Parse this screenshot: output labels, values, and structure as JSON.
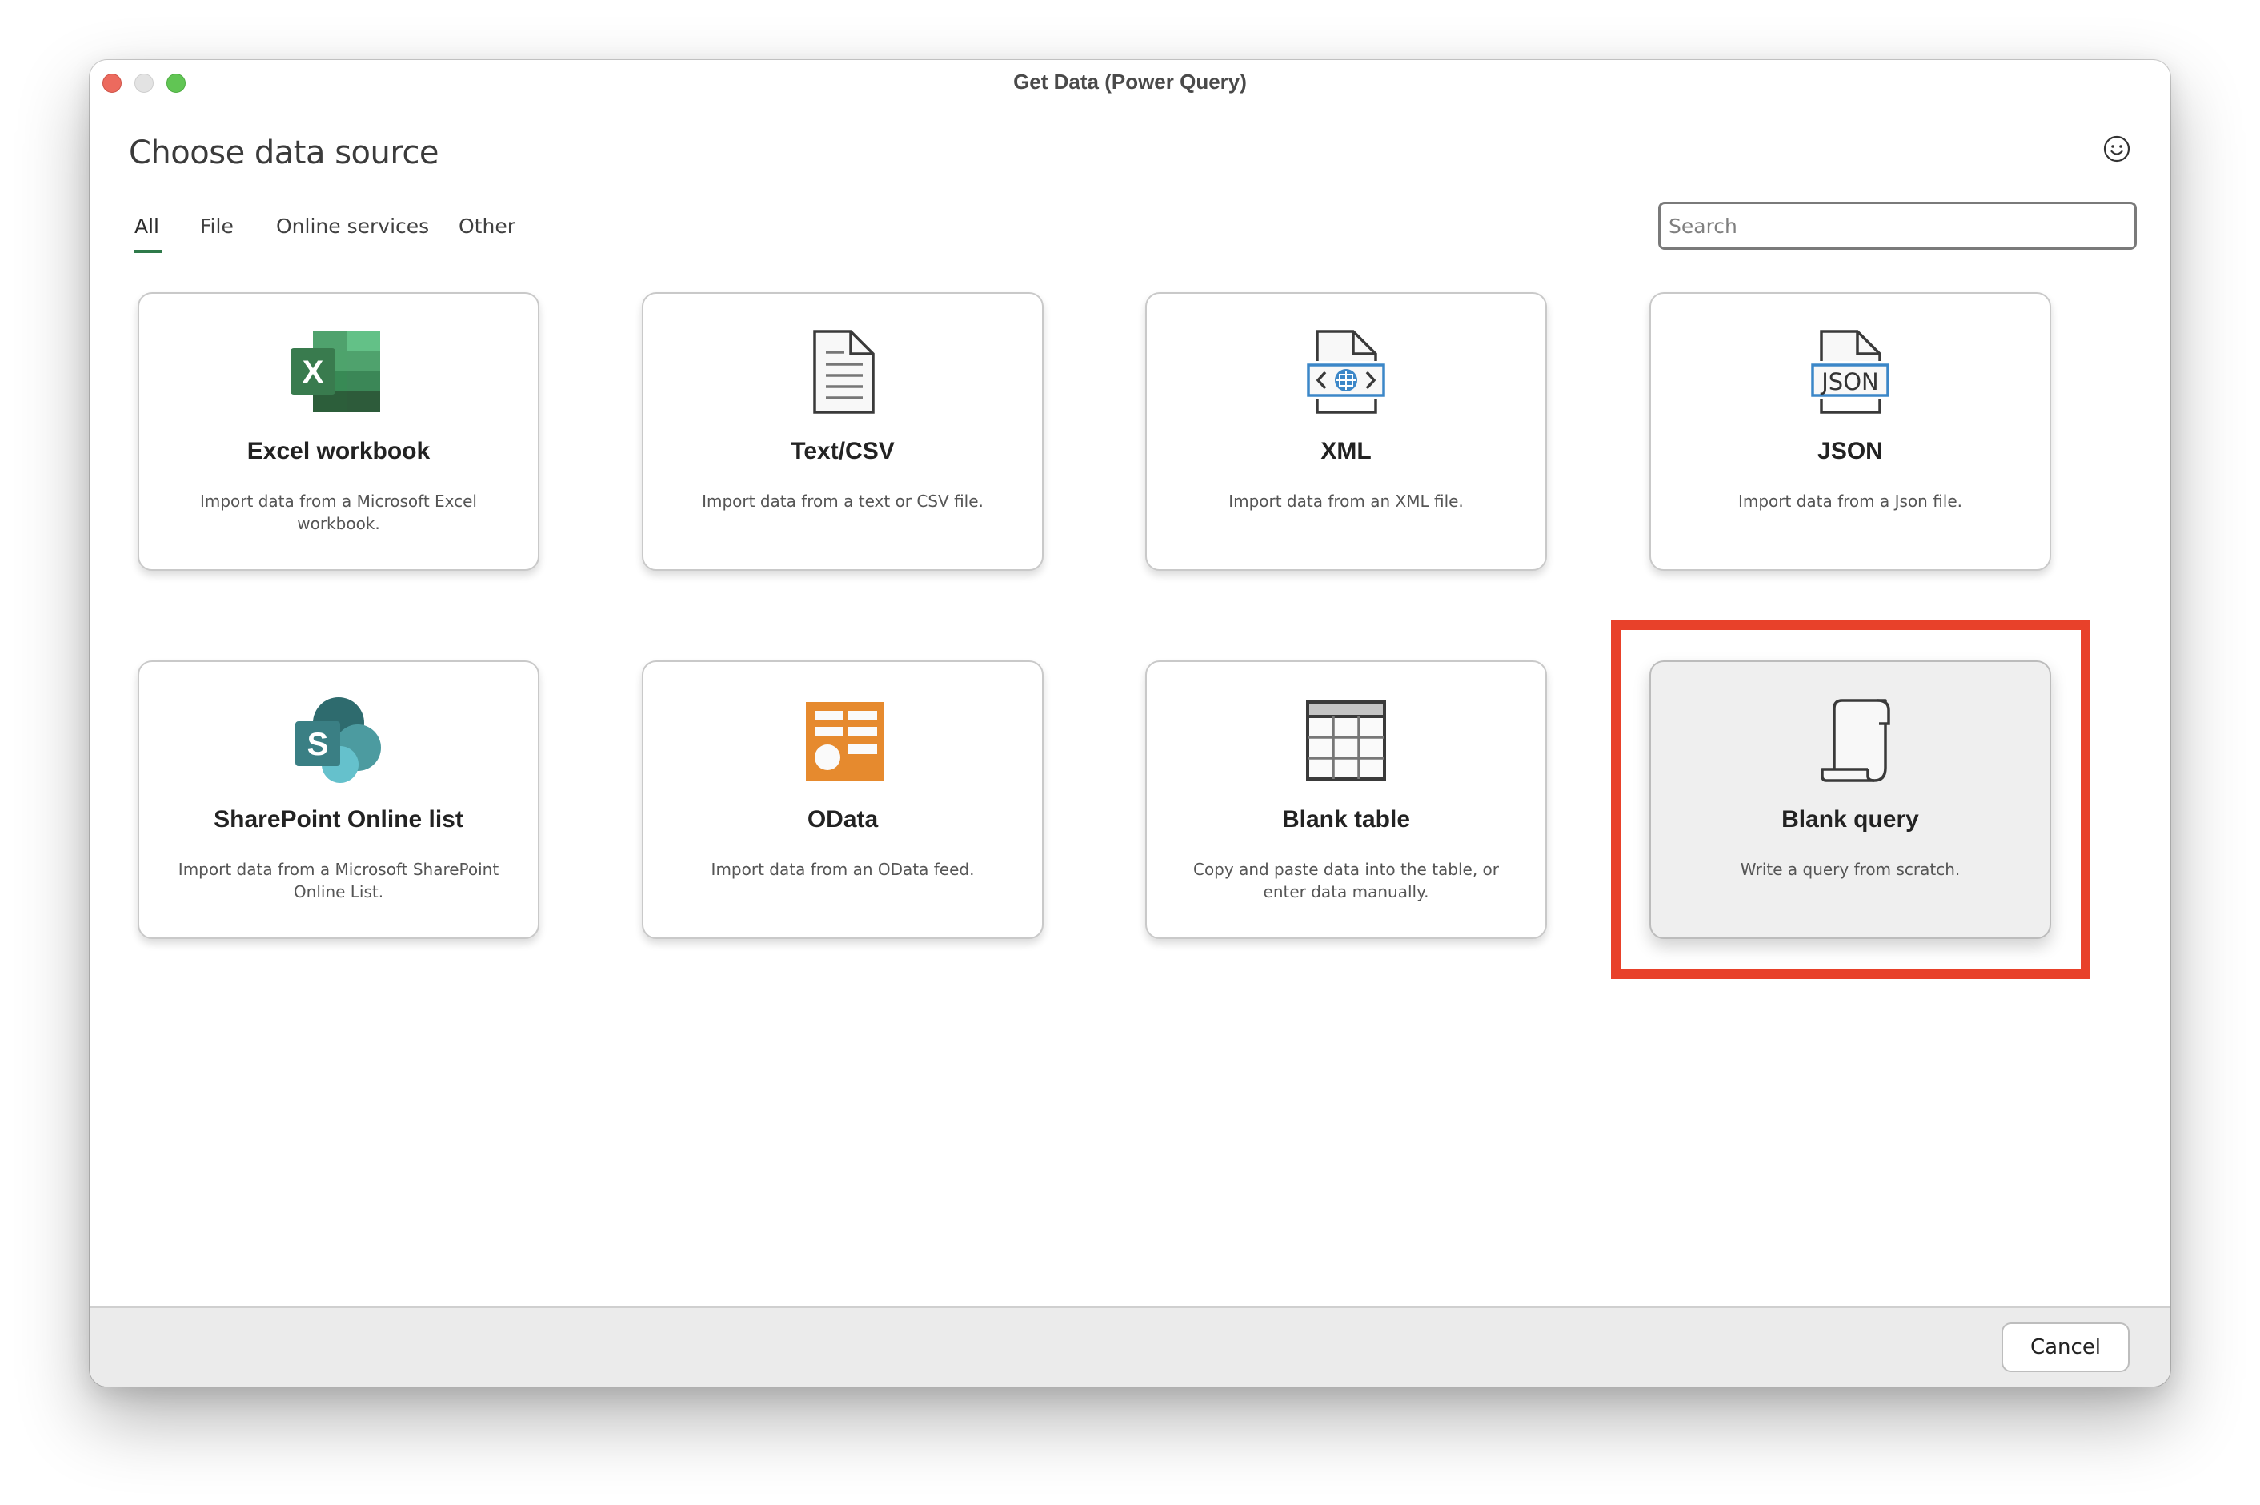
{
  "window": {
    "title": "Get Data (Power Query)"
  },
  "header": {
    "heading": "Choose data source",
    "feedback_icon": "smiley-icon"
  },
  "tabs": [
    {
      "label": "All",
      "active": true
    },
    {
      "label": "File",
      "active": false
    },
    {
      "label": "Online services",
      "active": false
    },
    {
      "label": "Other",
      "active": false
    }
  ],
  "search": {
    "placeholder": "Search",
    "value": ""
  },
  "sources": [
    {
      "title": "Excel workbook",
      "description": "Import data from a Microsoft Excel workbook.",
      "icon": "excel-icon"
    },
    {
      "title": "Text/CSV",
      "description": "Import data from a text or CSV file.",
      "icon": "text-file-icon"
    },
    {
      "title": "XML",
      "description": "Import data from an XML file.",
      "icon": "xml-file-icon"
    },
    {
      "title": "JSON",
      "description": "Import data from a Json file.",
      "icon": "json-file-icon",
      "icon_text": "JSON"
    },
    {
      "title": "SharePoint Online list",
      "description": "Import data from a Microsoft SharePoint Online List.",
      "icon": "sharepoint-icon",
      "icon_text": "S"
    },
    {
      "title": "OData",
      "description": "Import data from an OData feed.",
      "icon": "odata-icon"
    },
    {
      "title": "Blank table",
      "description": "Copy and paste data into the table, or enter data manually.",
      "icon": "table-icon"
    },
    {
      "title": "Blank query",
      "description": "Write a query from scratch.",
      "icon": "scroll-icon",
      "selected": true
    }
  ],
  "excel_icon_letter": "X",
  "footer": {
    "cancel_label": "Cancel"
  },
  "colors": {
    "tab_accent": "#2f7a4a",
    "highlight": "#e8412a",
    "excel_green": "#217346",
    "sharepoint_teal": "#036c70",
    "odata_orange": "#e68a2e",
    "xml_blue": "#3c87c8"
  }
}
